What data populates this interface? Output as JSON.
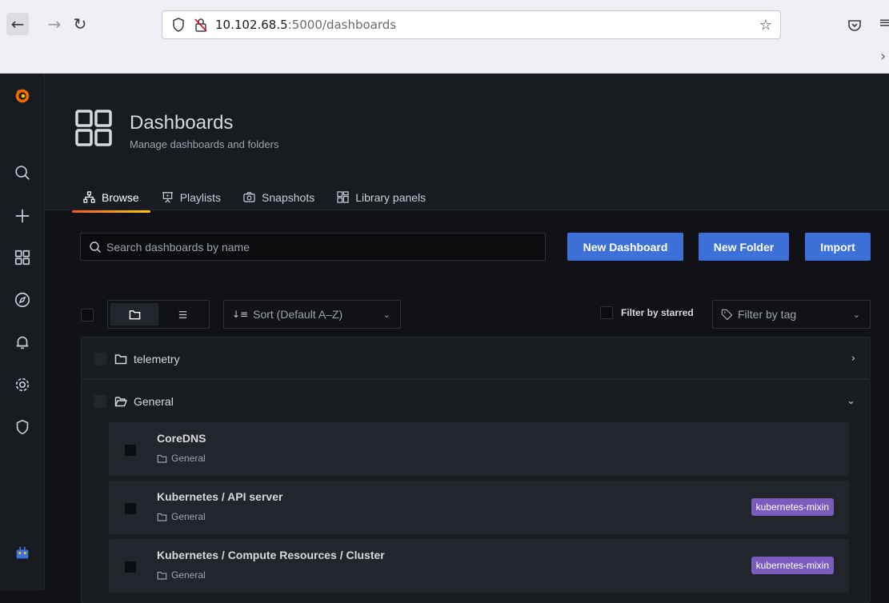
{
  "browser": {
    "url_host": "10.102.68.5",
    "url_rest": ":5000/dashboards"
  },
  "page": {
    "title": "Dashboards",
    "subtitle": "Manage dashboards and folders"
  },
  "tabs": [
    {
      "label": "Browse",
      "active": true
    },
    {
      "label": "Playlists",
      "active": false
    },
    {
      "label": "Snapshots",
      "active": false
    },
    {
      "label": "Library panels",
      "active": false
    }
  ],
  "toolbar": {
    "search_placeholder": "Search dashboards by name",
    "new_dashboard_label": "New Dashboard",
    "new_folder_label": "New Folder",
    "import_label": "Import"
  },
  "view": {
    "sort_label": "Sort (Default A–Z)",
    "filter_starred_label": "Filter by starred",
    "filter_tag_placeholder": "Filter by tag"
  },
  "folders": [
    {
      "name": "telemetry",
      "expanded": false
    },
    {
      "name": "General",
      "expanded": true
    }
  ],
  "dashboards": [
    {
      "title": "CoreDNS",
      "folder": "General",
      "tag": ""
    },
    {
      "title": "Kubernetes / API server",
      "folder": "General",
      "tag": "kubernetes-mixin"
    },
    {
      "title": "Kubernetes / Compute Resources / Cluster",
      "folder": "General",
      "tag": "kubernetes-mixin"
    }
  ],
  "colors": {
    "primary_button": "#3d71d9",
    "tag_purple": "#7c5bbf",
    "background": "#111217",
    "panel": "#181b1f",
    "accent_gradient_start": "#f05a28",
    "accent_gradient_end": "#fbca0a"
  },
  "icons": {
    "back": "arrow-left-icon",
    "forward": "arrow-right-icon",
    "reload": "reload-icon",
    "bookmark": "star-icon",
    "grafana_logo": "grafana-logo",
    "search": "search-icon",
    "create": "plus-icon",
    "dashboards": "apps-icon",
    "explore": "compass-icon",
    "alerting": "bell-icon",
    "configuration": "gear-icon",
    "server_admin": "shield-icon",
    "folder": "folder-icon"
  }
}
